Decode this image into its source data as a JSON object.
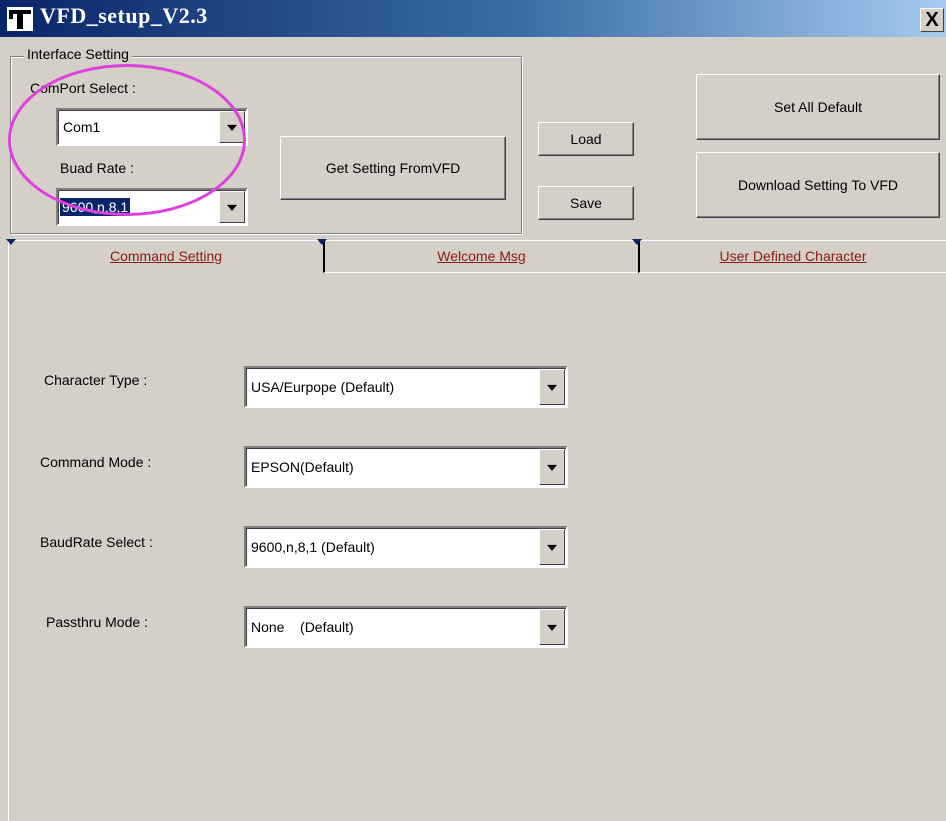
{
  "window": {
    "title": "VFD_setup_V2.3",
    "close_label": "X"
  },
  "interface": {
    "group_label": "Interface Setting",
    "comport_label": "ComPort Select :",
    "comport_value": "Com1",
    "baud_label": "Buad Rate :",
    "baud_value": "9600,n,8,1"
  },
  "buttons": {
    "get_setting": "Get Setting FromVFD",
    "load": "Load",
    "save": "Save",
    "set_default": "Set All Default",
    "download": "Download Setting To VFD"
  },
  "tabs": [
    {
      "label": "Command Setting"
    },
    {
      "label": "Welcome Msg"
    },
    {
      "label": "User Defined Character"
    }
  ],
  "command": {
    "char_type_label": "Character Type :",
    "char_type_value": "USA/Eurpope (Default)",
    "cmd_mode_label": "Command Mode :",
    "cmd_mode_value": "EPSON(Default)",
    "baud_select_label": "BaudRate Select :",
    "baud_select_value": "9600,n,8,1 (Default)",
    "passthru_label": "Passthru Mode :",
    "passthru_value": "None    (Default)"
  },
  "colors": {
    "title_bar": "#0a246a",
    "highlight": "#e040e0",
    "tab_text": "#8b1a1a"
  }
}
